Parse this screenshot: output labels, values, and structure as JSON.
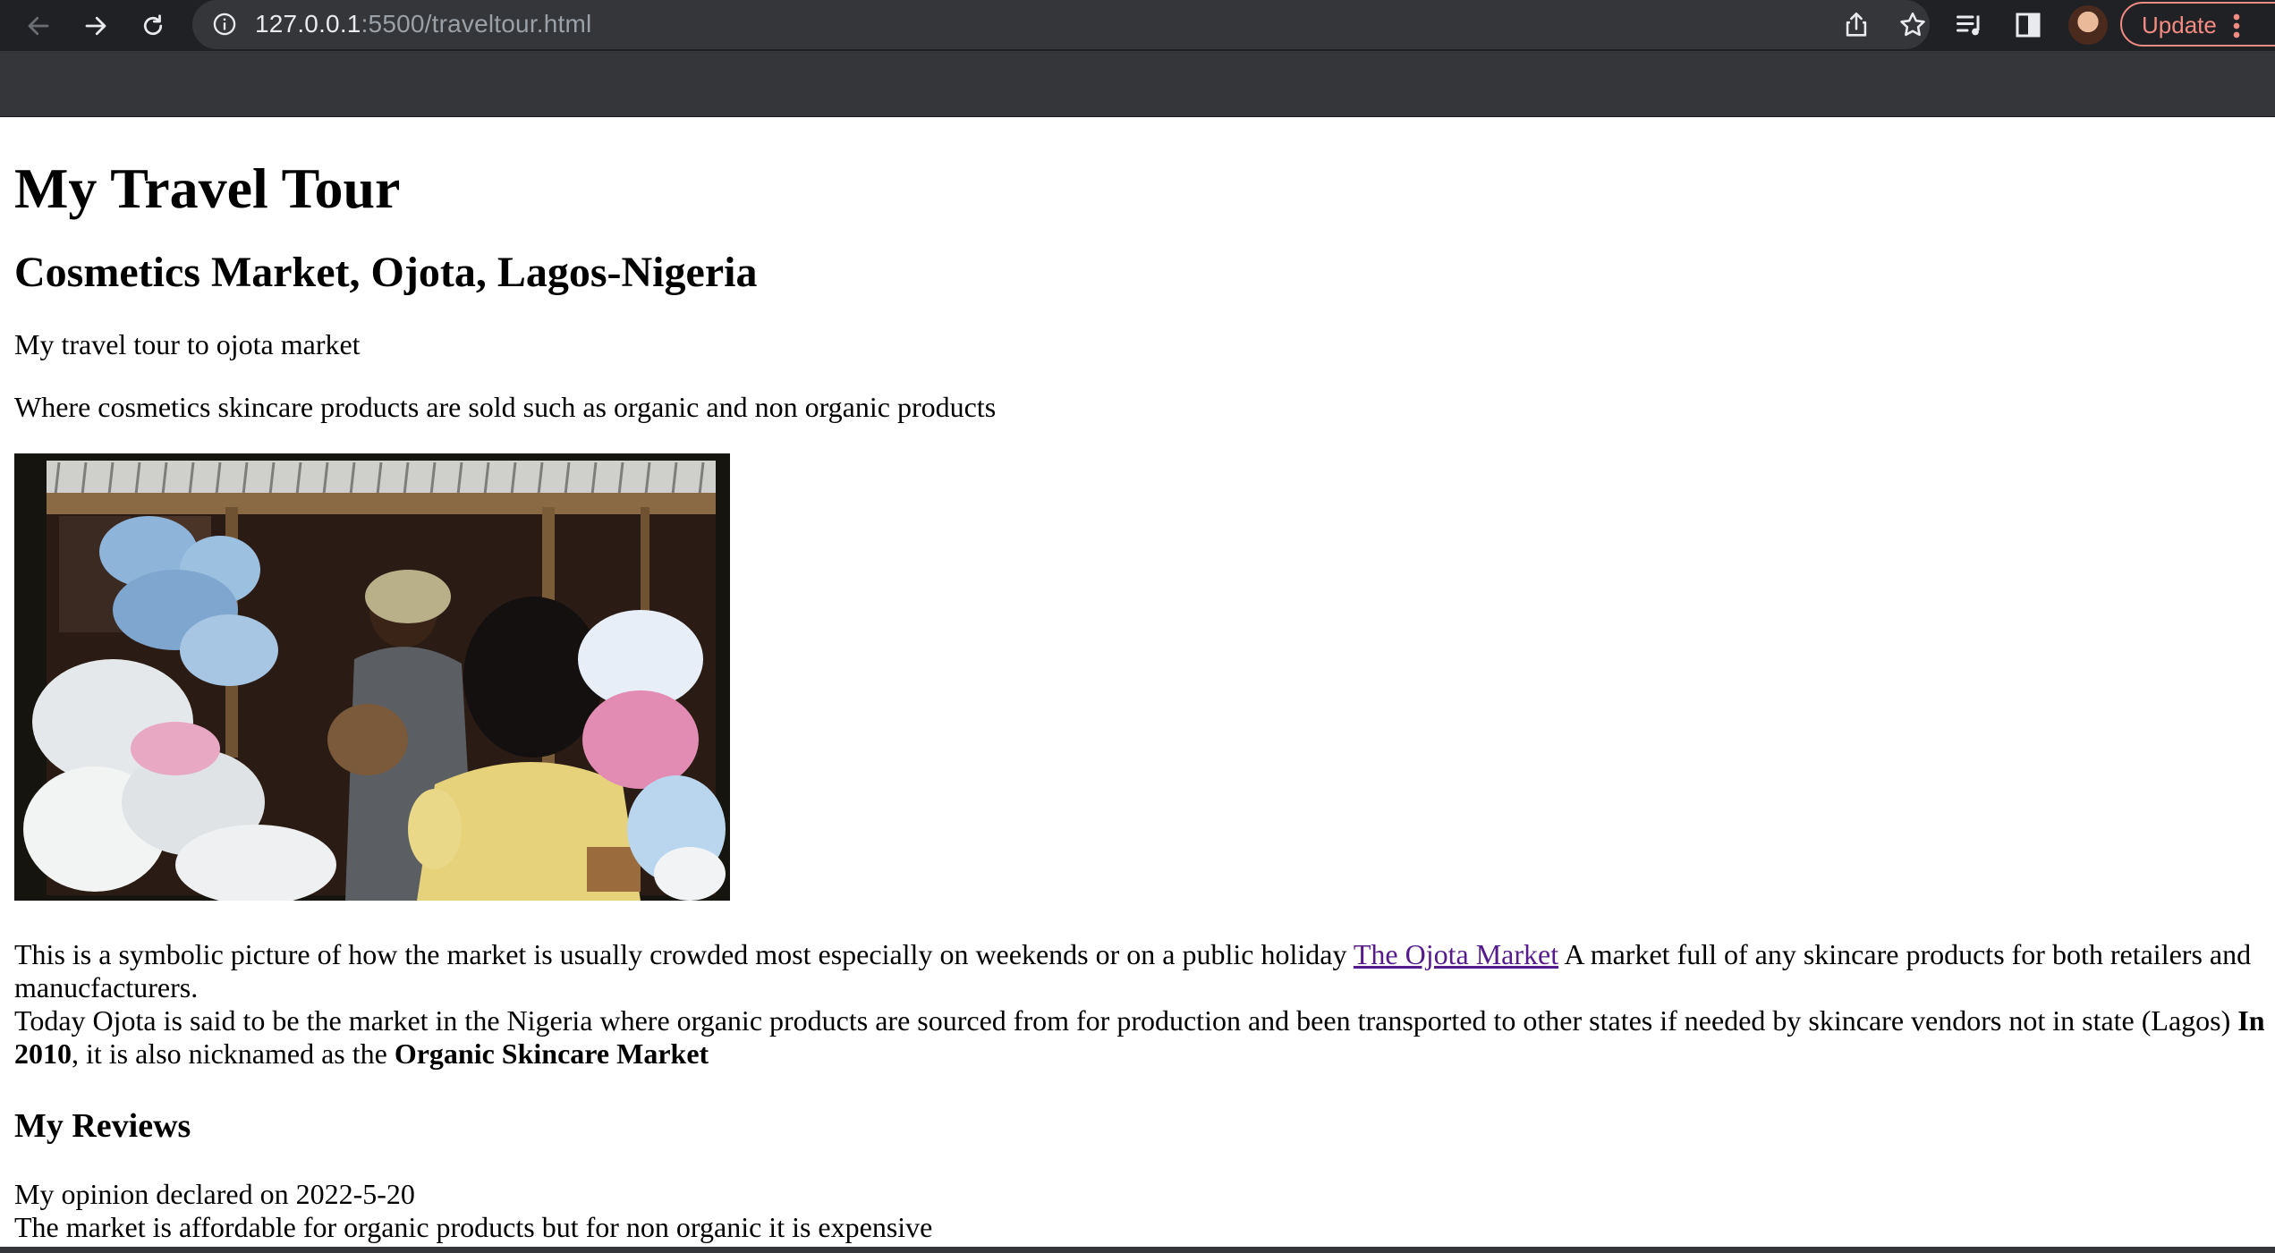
{
  "browser": {
    "url_host": "127.0.0.1",
    "url_rest": ":5500/traveltour.html",
    "update_label": "Update",
    "accent_color": "#f28b82"
  },
  "page": {
    "title": "My Travel Tour",
    "subtitle": "Cosmetics Market, Ojota, Lagos-Nigeria",
    "intro_1": "My travel tour to ojota market",
    "intro_2": "Where cosmetics skincare products are sold such as organic and non organic products",
    "paragraph_1_before_link": "This is a symbolic picture of how the market is usually crowded most especially on weekends or on a public holiday ",
    "link_text": "The Ojota Market",
    "paragraph_1_after_link": " A market full of any skincare products for both retailers and manucfacturers.",
    "paragraph_2_before_bold": "Today Ojota is said to be the market in the Nigeria where organic products are sourced from for production and been transported to other states if needed by skincare vendors not in state (Lagos) ",
    "paragraph_2_bold_1": "In 2010",
    "paragraph_2_middle": ", it is also nicknamed as the ",
    "paragraph_2_bold_2": "Organic Skincare Market",
    "reviews_heading": "My Reviews",
    "review_line_1": "My opinion declared on 2022-5-20",
    "review_line_2": "The market is affordable for organic products but for non organic it is expensive"
  }
}
